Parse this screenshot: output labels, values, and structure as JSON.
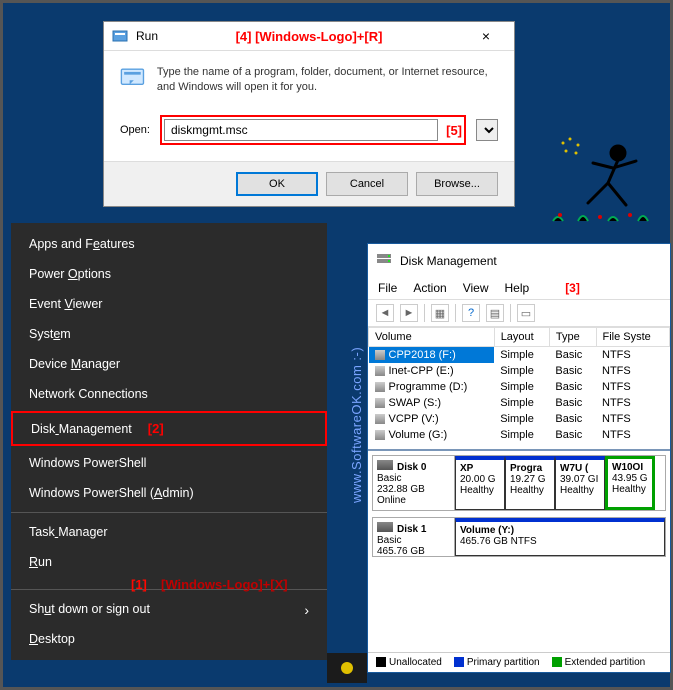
{
  "run": {
    "title": "Run",
    "annotation": "[4] [Windows-Logo]+[R]",
    "description": "Type the name of a program, folder, document, or Internet resource, and Windows will open it for you.",
    "open_label": "Open:",
    "input_value": "diskmgmt.msc",
    "input_annotation": "[5]",
    "ok": "OK",
    "cancel": "Cancel",
    "browse": "Browse...",
    "close": "×"
  },
  "ctx": {
    "items": [
      {
        "label": "Apps and Features",
        "u": 10
      },
      {
        "label": "Power Options",
        "u": 6
      },
      {
        "label": "Event Viewer",
        "u": 6
      },
      {
        "label": "System",
        "u": 4
      },
      {
        "label": "Device Manager",
        "u": 7
      },
      {
        "label": "Network Connections",
        "u": -1
      },
      {
        "label": "Disk Management",
        "u": 4,
        "hl": true,
        "annot": "[2]"
      },
      {
        "label": "Windows PowerShell",
        "u": -1
      },
      {
        "label": "Windows PowerShell (Admin)",
        "u": 20
      }
    ],
    "items2": [
      {
        "label": "Task Manager",
        "u": 4
      },
      {
        "label": "Run",
        "u": 0,
        "ann1": "[1]",
        "ann1b": "[Windows-Logo]+[X]"
      }
    ],
    "items3": [
      {
        "label": "Shut down or sign out",
        "u": 2,
        "sub": true
      },
      {
        "label": "Desktop",
        "u": 0
      }
    ]
  },
  "dm": {
    "title": "Disk Management",
    "menu": [
      "File",
      "Action",
      "View",
      "Help"
    ],
    "annot3": "[3]",
    "cols": [
      "Volume",
      "Layout",
      "Type",
      "File Syste"
    ],
    "rows": [
      {
        "v": "CPP2018 (F:)",
        "l": "Simple",
        "t": "Basic",
        "f": "NTFS",
        "sel": true
      },
      {
        "v": "Inet-CPP (E:)",
        "l": "Simple",
        "t": "Basic",
        "f": "NTFS"
      },
      {
        "v": "Programme (D:)",
        "l": "Simple",
        "t": "Basic",
        "f": "NTFS"
      },
      {
        "v": "SWAP (S:)",
        "l": "Simple",
        "t": "Basic",
        "f": "NTFS"
      },
      {
        "v": "VCPP (V:)",
        "l": "Simple",
        "t": "Basic",
        "f": "NTFS"
      },
      {
        "v": "Volume (G:)",
        "l": "Simple",
        "t": "Basic",
        "f": "NTFS"
      }
    ],
    "disk0": {
      "name": "Disk 0",
      "type": "Basic",
      "size": "232.88 GB",
      "status": "Online"
    },
    "parts0": [
      {
        "n": "XP",
        "s": "20.00 G",
        "st": "Healthy"
      },
      {
        "n": "Progra",
        "s": "19.27 G",
        "st": "Healthy"
      },
      {
        "n": "W7U (",
        "s": "39.07 GI",
        "st": "Healthy"
      },
      {
        "n": "W10OI",
        "s": "43.95 G",
        "st": "Healthy",
        "ext": true
      }
    ],
    "disk1": {
      "name": "Disk 1",
      "type": "Basic",
      "size": "465.76 GB"
    },
    "vol_y": "Volume  (Y:)",
    "vol_y2": "465.76 GB NTFS",
    "legend": [
      {
        "c": "#000",
        "t": "Unallocated"
      },
      {
        "c": "#0030d0",
        "t": "Primary partition"
      },
      {
        "c": "#00a000",
        "t": "Extended partition"
      }
    ]
  },
  "watermark": "www.SoftwareOK.com :-)"
}
